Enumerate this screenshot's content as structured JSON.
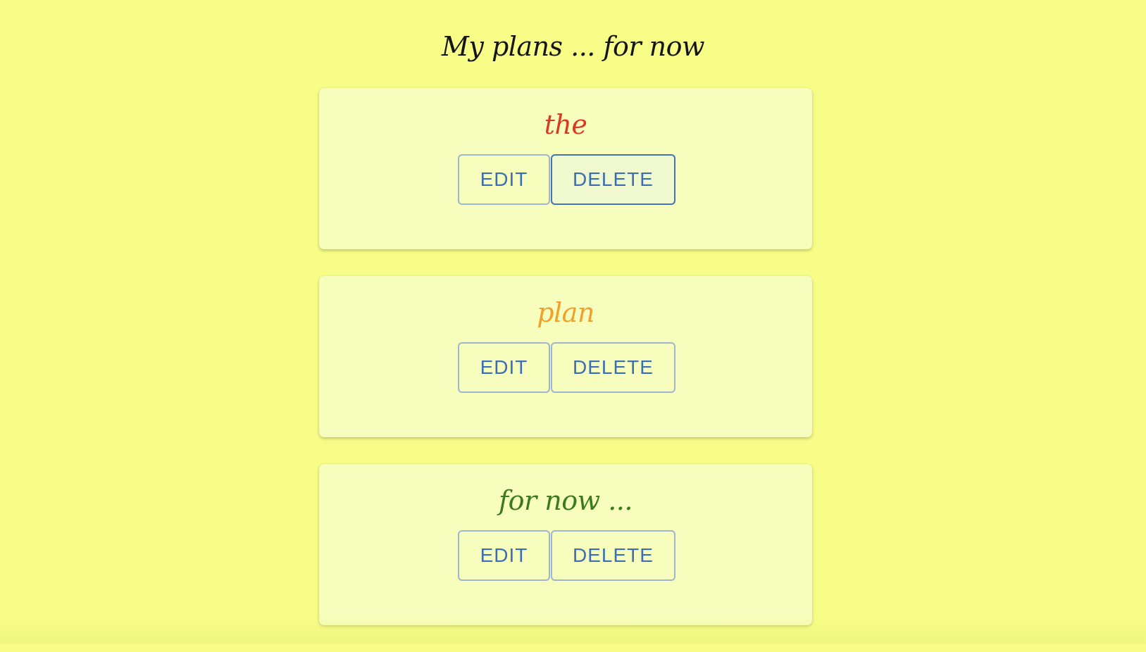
{
  "page": {
    "title": "My plans ... for now"
  },
  "plans": [
    {
      "title": "the",
      "title_color": "#d93a22",
      "edit_label": "EDIT",
      "delete_label": "DELETE"
    },
    {
      "title": "plan",
      "title_color": "#f0a02c",
      "edit_label": "EDIT",
      "delete_label": "DELETE"
    },
    {
      "title": "for now ...",
      "title_color": "#3c7a1e",
      "edit_label": "EDIT",
      "delete_label": "DELETE"
    }
  ],
  "colors": {
    "background": "#f7fd86",
    "card": "#f6fdbd",
    "button_text": "#3c6eb8"
  }
}
